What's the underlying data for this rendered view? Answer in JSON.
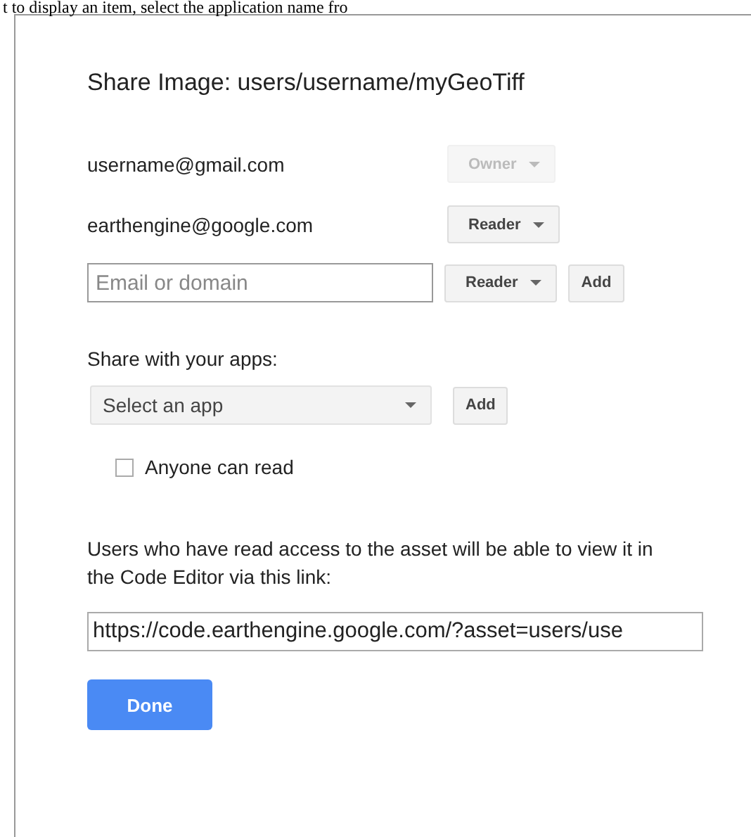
{
  "page_text": "t to display an item, select the application name fro",
  "dialog": {
    "title": "Share Image: users/username/myGeoTiff",
    "members": [
      {
        "email": "username@gmail.com",
        "role": "Owner",
        "disabled": true
      },
      {
        "email": "earthengine@google.com",
        "role": "Reader",
        "disabled": false
      }
    ],
    "invite": {
      "placeholder": "Email or domain",
      "role": "Reader",
      "add": "Add"
    },
    "apps": {
      "label": "Share with your apps:",
      "placeholder": "Select an app",
      "add": "Add"
    },
    "anyone": {
      "label": "Anyone can read",
      "checked": false
    },
    "link_note": "Users who have read access to the asset will be able to view it in the Code Editor via this link:",
    "link": "https://code.earthengine.google.com/?asset=users/use",
    "done": "Done"
  }
}
